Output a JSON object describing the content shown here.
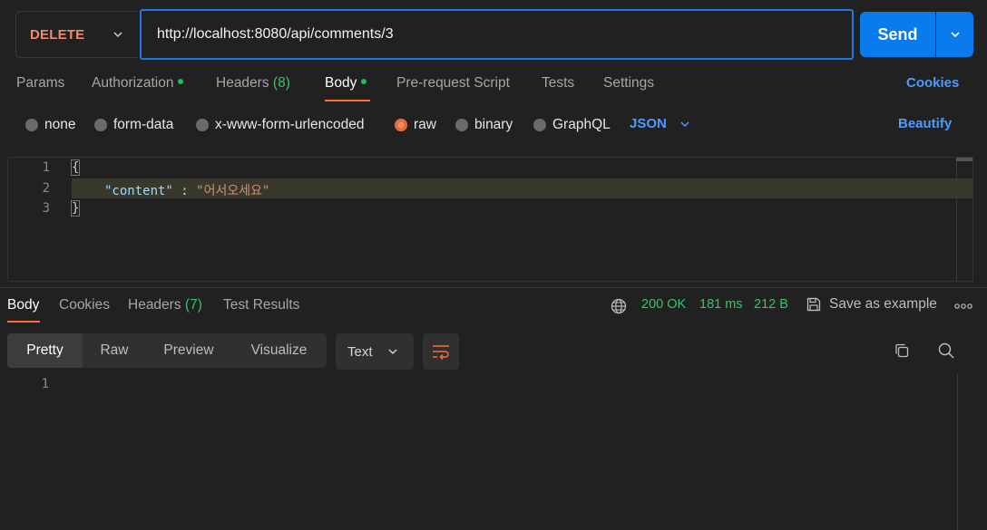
{
  "request": {
    "method": "DELETE",
    "url": "http://localhost:8080/api/comments/3",
    "send_label": "Send"
  },
  "request_tabs": {
    "params": "Params",
    "authorization": "Authorization",
    "headers": "Headers",
    "headers_count": "(8)",
    "body": "Body",
    "pre_request": "Pre-request Script",
    "tests": "Tests",
    "settings": "Settings",
    "cookies": "Cookies"
  },
  "body_types": {
    "none": "none",
    "form_data": "form-data",
    "urlencoded": "x-www-form-urlencoded",
    "raw": "raw",
    "binary": "binary",
    "graphql": "GraphQL",
    "format": "JSON",
    "beautify": "Beautify"
  },
  "editor": {
    "line_numbers": [
      "1",
      "2",
      "3"
    ],
    "open_brace": "{",
    "key": "\"content\"",
    "colon": " : ",
    "value": "\"어서오세요\"",
    "close_brace": "}"
  },
  "response_tabs": {
    "body": "Body",
    "cookies": "Cookies",
    "headers": "Headers",
    "headers_count": "(7)",
    "test_results": "Test Results"
  },
  "response_status": {
    "status": "200 OK",
    "time": "181 ms",
    "size": "212 B",
    "save_example": "Save as example",
    "more": "ooo"
  },
  "response_view": {
    "pretty": "Pretty",
    "raw": "Raw",
    "preview": "Preview",
    "visualize": "Visualize",
    "format": "Text",
    "line_numbers": [
      "1"
    ]
  },
  "colors": {
    "accent_orange": "#ff6c37",
    "send_blue": "#097bed",
    "status_green": "#3cc06a",
    "link_blue": "#4b9cff",
    "method_delete": "#f08a6c"
  }
}
